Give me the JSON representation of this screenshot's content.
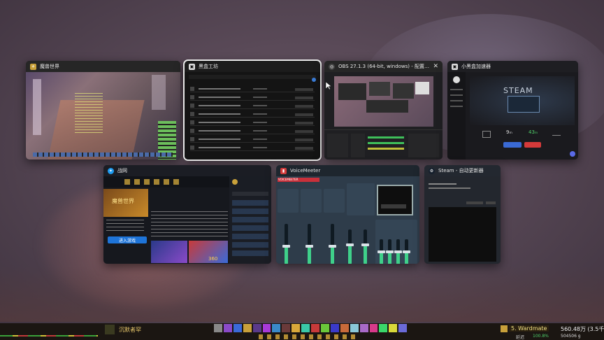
{
  "windows": [
    {
      "id": "wow",
      "title": "魔兽世界",
      "icon_color": "#c9a13a",
      "icon_name": "wow-icon"
    },
    {
      "id": "heihe",
      "title": "黑盒工坊",
      "icon_color": "#dddddd",
      "icon_name": "heihe-icon"
    },
    {
      "id": "obs",
      "title": "OBS 27.1.3 (64-bit, windows) - 配置文件: 未命名 - 场景...",
      "icon_color": "#444444",
      "icon_name": "obs-icon",
      "close": "✕"
    },
    {
      "id": "xhh",
      "title": "小黑盒加速器",
      "icon_color": "#dddddd",
      "icon_name": "xhh-accel-icon"
    },
    {
      "id": "bnet",
      "title": "战网",
      "icon_color": "#1e9bf0",
      "icon_name": "battlenet-icon"
    },
    {
      "id": "vm",
      "title": "VoiceMeeter",
      "icon_color": "#d23b3b",
      "icon_name": "voicemeeter-icon"
    },
    {
      "id": "steamupd",
      "title": "Steam - 自动更新器",
      "icon_color": "#16202d",
      "icon_name": "steam-icon"
    }
  ],
  "xhh": {
    "steam_label": "STEAM",
    "stat1": "9ₘ",
    "stat2": "43ₘ"
  },
  "bnet": {
    "button": "进入游戏",
    "banner_left": "魔兽世界",
    "banner_right": "360"
  },
  "steamupd": {
    "line1": "Steam - 自动更新器",
    "line2": "Steam 正在下载更新..."
  },
  "vm_label": "VOICEMEETER",
  "taskbar": {
    "left_text": "沉默者罕",
    "right_name": "5. Wardmate",
    "gold": "560.48万 (3.5千)",
    "latency": "100.8%",
    "cash": "504506 g",
    "fps_label": "延迟"
  }
}
